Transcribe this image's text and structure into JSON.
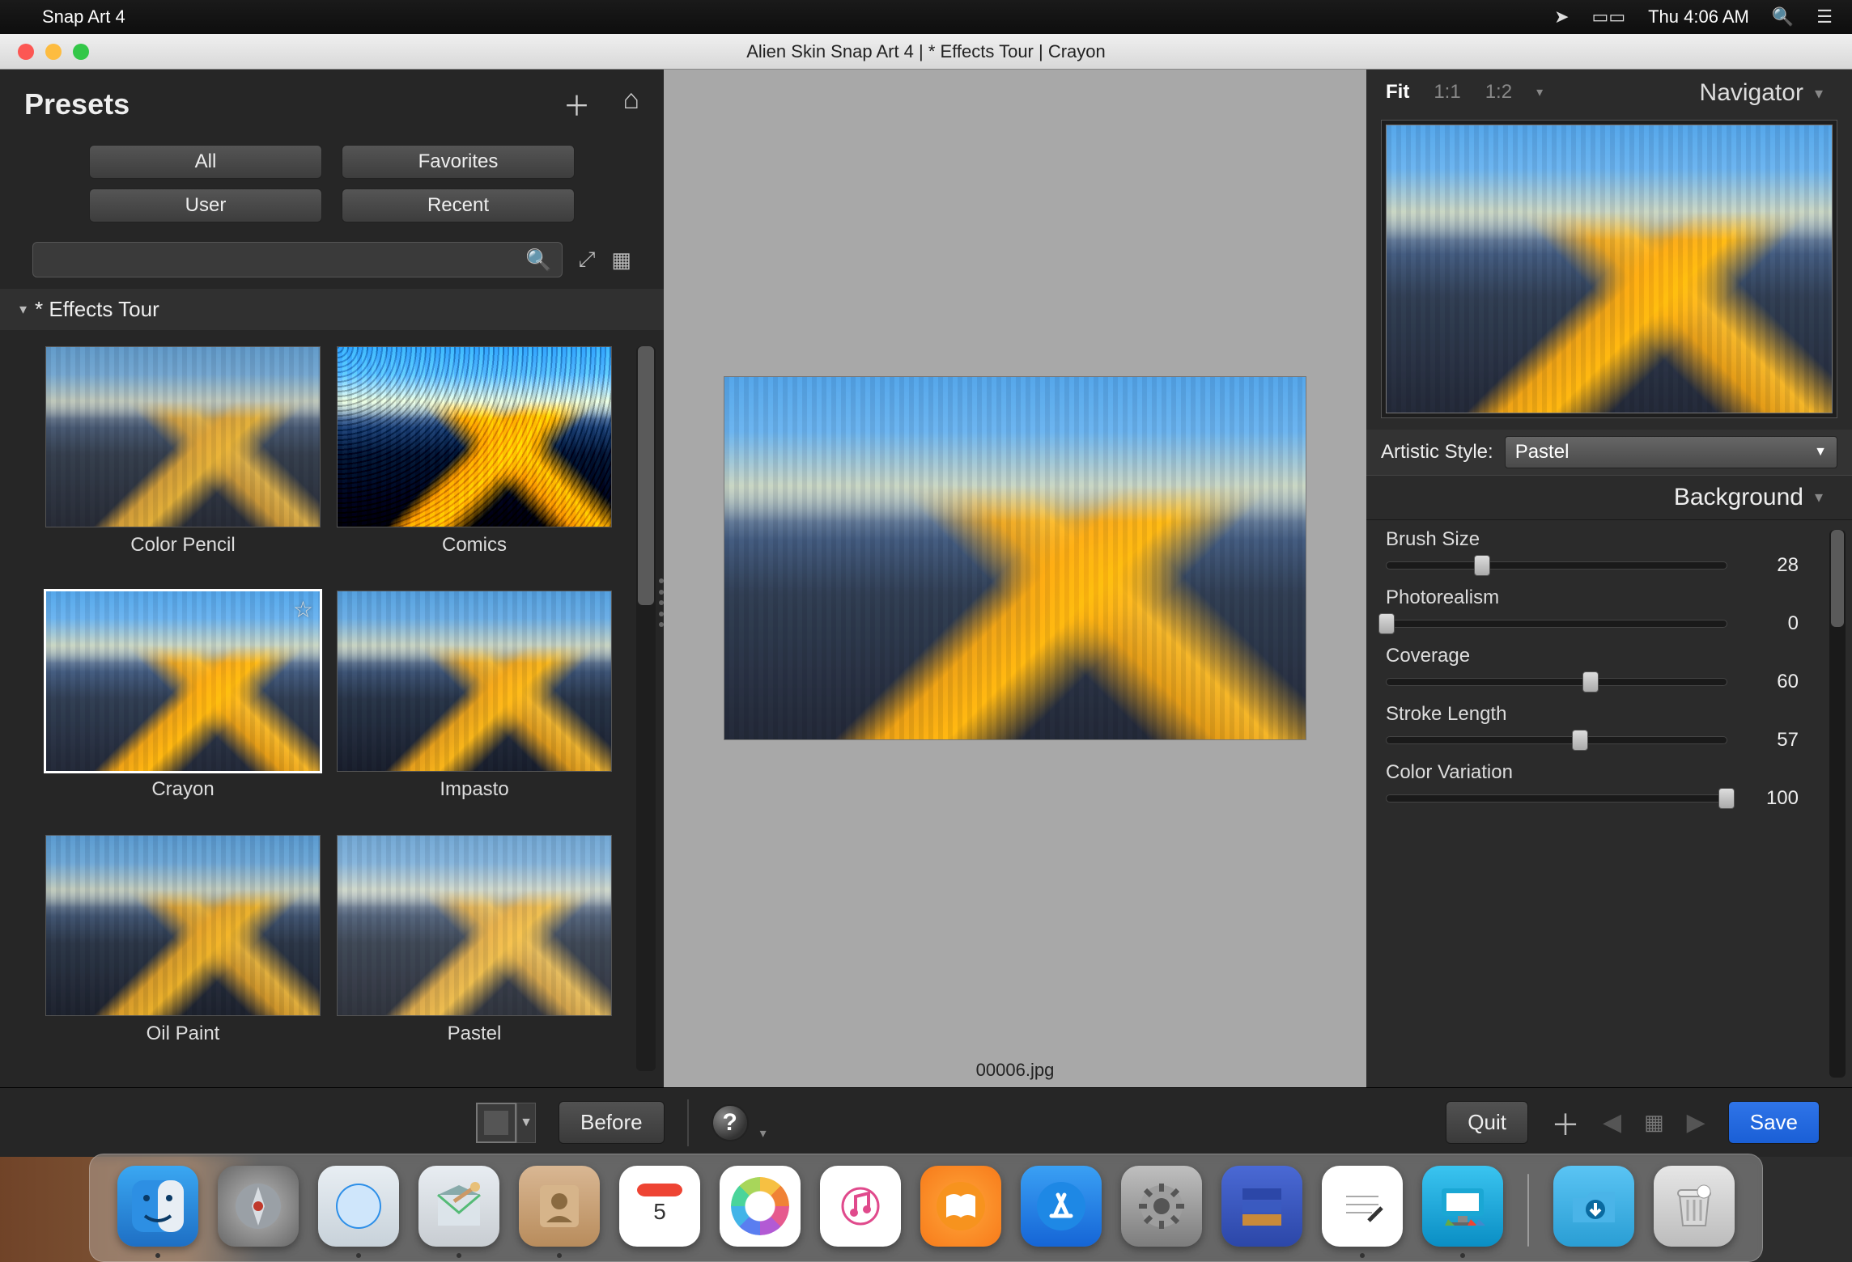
{
  "menubar": {
    "app_name": "Snap Art 4",
    "clock": "Thu 4:06 AM"
  },
  "window": {
    "title": "Alien Skin Snap Art 4 | * Effects Tour | Crayon"
  },
  "presets": {
    "title": "Presets",
    "tabs": {
      "all": "All",
      "favorites": "Favorites",
      "user": "User",
      "recent": "Recent"
    },
    "category": "* Effects Tour",
    "items": [
      {
        "label": "Color Pencil",
        "variant": ""
      },
      {
        "label": "Comics",
        "variant": "v-comics"
      },
      {
        "label": "Crayon",
        "variant": "v-crayon",
        "selected": true,
        "star": true
      },
      {
        "label": "Impasto",
        "variant": "v-impasto"
      },
      {
        "label": "Oil Paint",
        "variant": "v-oil"
      },
      {
        "label": "Pastel",
        "variant": "v-pastel"
      }
    ]
  },
  "canvas": {
    "filename": "00006.jpg"
  },
  "zoom": {
    "fit": "Fit",
    "one_to_one": "1:1",
    "one_to_two": "1:2"
  },
  "navigator": {
    "title": "Navigator"
  },
  "style": {
    "label": "Artistic Style:",
    "value": "Pastel"
  },
  "background_section": {
    "title": "Background",
    "sliders": [
      {
        "label": "Brush Size",
        "value": 28,
        "min": 0,
        "max": 100
      },
      {
        "label": "Photorealism",
        "value": 0,
        "min": 0,
        "max": 100
      },
      {
        "label": "Coverage",
        "value": 60,
        "min": 0,
        "max": 100
      },
      {
        "label": "Stroke Length",
        "value": 57,
        "min": 0,
        "max": 100
      },
      {
        "label": "Color Variation",
        "value": 100,
        "min": 0,
        "max": 100
      }
    ]
  },
  "bottom": {
    "before": "Before",
    "quit": "Quit",
    "save": "Save"
  },
  "dock": {
    "items": [
      "finder",
      "launchpad",
      "safari",
      "mail",
      "contacts",
      "calendar",
      "photos",
      "music",
      "ibooks",
      "appstore",
      "sysprefs",
      "box",
      "notes",
      "display"
    ],
    "right": [
      "downloads",
      "trash"
    ],
    "running": [
      "finder",
      "safari",
      "mail",
      "contacts",
      "notes",
      "display"
    ]
  }
}
